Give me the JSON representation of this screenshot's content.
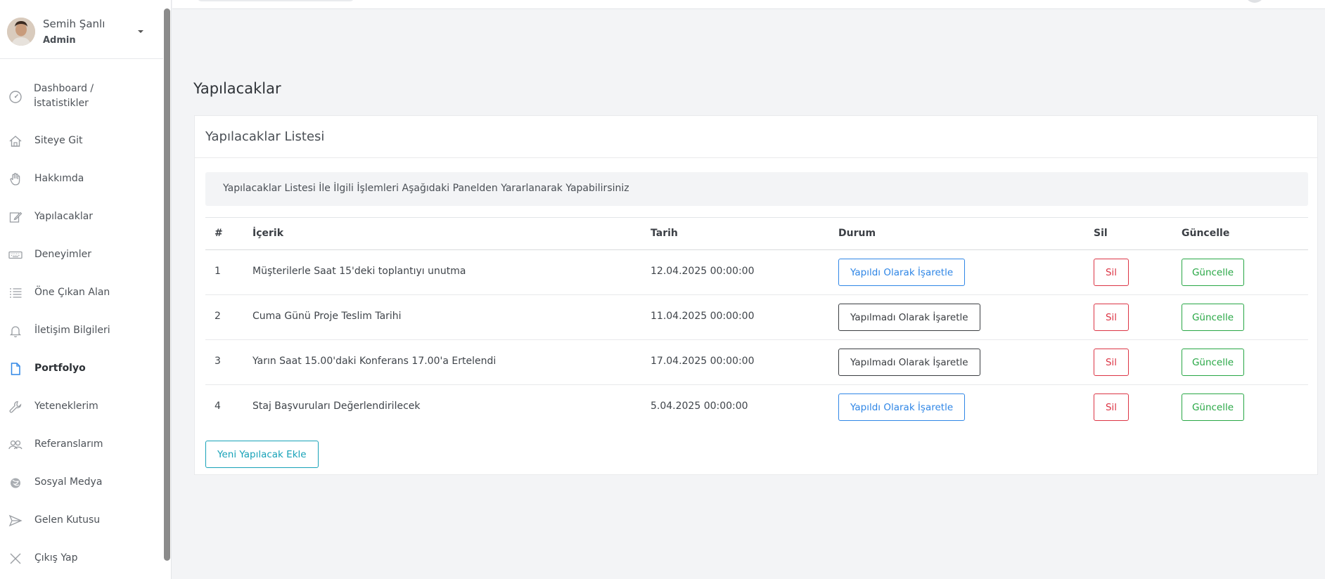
{
  "user": {
    "name": "Semih Şanlı",
    "role": "Admin"
  },
  "sidebar": {
    "items": [
      {
        "label": "Dashboard / İstatistikler",
        "icon": "gauge-icon"
      },
      {
        "label": "Siteye Git",
        "icon": "home-icon"
      },
      {
        "label": "Hakkımda",
        "icon": "hand-icon"
      },
      {
        "label": "Yapılacaklar",
        "icon": "edit-icon"
      },
      {
        "label": "Deneyimler",
        "icon": "keyboard-icon"
      },
      {
        "label": "Öne Çıkan Alan",
        "icon": "list-icon"
      },
      {
        "label": "İletişim Bilgileri",
        "icon": "bell-icon"
      },
      {
        "label": "Portfolyo",
        "icon": "document-icon",
        "active": true
      },
      {
        "label": "Yeteneklerim",
        "icon": "wrench-icon"
      },
      {
        "label": "Referanslarım",
        "icon": "users-icon"
      },
      {
        "label": "Sosyal Medya",
        "icon": "firefox-icon"
      },
      {
        "label": "Gelen Kutusu",
        "icon": "send-icon"
      },
      {
        "label": "Çıkış Yap",
        "icon": "close-icon"
      }
    ]
  },
  "page": {
    "title": "Yapılacaklar"
  },
  "card": {
    "title": "Yapılacaklar Listesi",
    "alert": "Yapılacaklar Listesi İle İlgili İşlemleri Aşağıdaki Panelden Yararlanarak Yapabilirsiniz",
    "add_button": "Yeni Yapılacak Ekle"
  },
  "table": {
    "headers": {
      "num": "#",
      "content": "İçerik",
      "date": "Tarih",
      "status": "Durum",
      "delete": "Sil",
      "update": "Güncelle"
    },
    "rows": [
      {
        "num": "1",
        "content": "Müşterilerle Saat 15'deki toplantıyı unutma",
        "date": "12.04.2025 00:00:00",
        "status_label": "Yapıldı Olarak İşaretle",
        "delete_label": "Sil",
        "update_label": "Güncelle"
      },
      {
        "num": "2",
        "content": "Cuma Günü Proje Teslim Tarihi",
        "date": "11.04.2025 00:00:00",
        "status_label": "Yapılmadı Olarak İşaretle",
        "delete_label": "Sil",
        "update_label": "Güncelle"
      },
      {
        "num": "3",
        "content": "Yarın Saat 15.00'daki Konferans 17.00'a Ertelendi",
        "date": "17.04.2025 00:00:00",
        "status_label": "Yapılmadı Olarak İşaretle",
        "delete_label": "Sil",
        "update_label": "Güncelle"
      },
      {
        "num": "4",
        "content": "Staj Başvuruları Değerlendirilecek",
        "date": "5.04.2025 00:00:00",
        "status_label": "Yapıldı Olarak İşaretle",
        "delete_label": "Sil",
        "update_label": "Güncelle"
      }
    ]
  },
  "colors": {
    "done": "#2f86e6",
    "undone": "#3a3d41",
    "delete": "#dc3545",
    "update": "#28a745",
    "add": "#17a2b8"
  }
}
